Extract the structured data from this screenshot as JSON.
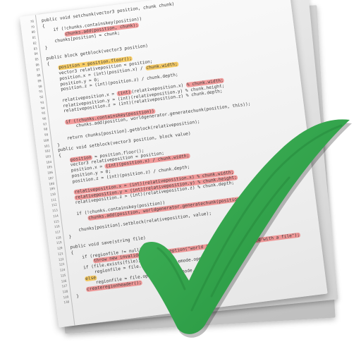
{
  "code_lines": [
    {
      "num": "78",
      "segments": [
        {
          "text": "public void setchunk(vector3 position, chunk chunk)"
        }
      ]
    },
    {
      "num": "79",
      "segments": [
        {
          "text": "{"
        }
      ]
    },
    {
      "num": "80",
      "segments": [
        {
          "text": "    if (!chunks.containskey(position))"
        }
      ]
    },
    {
      "num": "81",
      "segments": [
        {
          "text": "        "
        },
        {
          "text": "chunks.add(position, chunk);",
          "hl": "red"
        }
      ]
    },
    {
      "num": "82",
      "segments": [
        {
          "text": "    chunks[position] = chunk;"
        }
      ]
    },
    {
      "num": "83",
      "segments": [
        {
          "text": "}"
        }
      ]
    },
    {
      "num": "84",
      "segments": [
        {
          "text": ""
        }
      ]
    },
    {
      "num": "85",
      "segments": [
        {
          "text": "public block getblock(vector3 position)"
        }
      ]
    },
    {
      "num": "86",
      "segments": [
        {
          "text": "{"
        }
      ]
    },
    {
      "num": "87",
      "segments": [
        {
          "text": "    "
        },
        {
          "text": "position = position.floor();",
          "hl": "orange"
        }
      ]
    },
    {
      "num": "88",
      "segments": [
        {
          "text": "    vector3 relativeposition = position;"
        }
      ]
    },
    {
      "num": "89",
      "segments": [
        {
          "text": "    position.x = (int)(position.x) / "
        },
        {
          "text": "chunk.width;",
          "hl": "orange"
        }
      ]
    },
    {
      "num": "90",
      "segments": [
        {
          "text": "    position.y = 0;"
        }
      ]
    },
    {
      "num": "91",
      "segments": [
        {
          "text": "    position.z = (int)(position.z) / chunk.depth;"
        }
      ]
    },
    {
      "num": "92",
      "segments": [
        {
          "text": ""
        }
      ]
    },
    {
      "num": "93",
      "segments": [
        {
          "text": "    relativeposition.x = "
        },
        {
          "text": "(int)",
          "hl": "red"
        },
        {
          "text": "(relativeposition.x) "
        },
        {
          "text": "% chunk.width;",
          "hl": "red"
        }
      ]
    },
    {
      "num": "94",
      "segments": [
        {
          "text": "    relativeposition.y = (int)(relativeposition.y) % chunk.height;"
        }
      ]
    },
    {
      "num": "95",
      "segments": [
        {
          "text": "    relativeposition.z = (int)(relativeposition.z) % chunk.depth;"
        }
      ]
    },
    {
      "num": "96",
      "segments": [
        {
          "text": ""
        }
      ]
    },
    {
      "num": "97",
      "segments": [
        {
          "text": "    "
        },
        {
          "text": "if (!chunks.containskey(position))",
          "hl": "red"
        }
      ]
    },
    {
      "num": "98",
      "segments": [
        {
          "text": "        chunks.add(position, worldgenerator.generatechunk(position, this));"
        }
      ]
    },
    {
      "num": "99",
      "segments": [
        {
          "text": ""
        }
      ]
    },
    {
      "num": "100",
      "segments": [
        {
          "text": "    return chunks[position].getblock(relativeposition);"
        }
      ]
    },
    {
      "num": "101",
      "segments": [
        {
          "text": "}"
        }
      ]
    },
    {
      "num": "102",
      "segments": [
        {
          "text": "public void setblock(vector3 position, block value)"
        }
      ]
    },
    {
      "num": "103",
      "segments": [
        {
          "text": "{"
        }
      ]
    },
    {
      "num": "104",
      "segments": [
        {
          "text": "    "
        },
        {
          "text": "position",
          "hl": "red"
        },
        {
          "text": " = position.floor();"
        }
      ]
    },
    {
      "num": "105",
      "segments": [
        {
          "text": "    vector3 relativeposition = position;"
        }
      ]
    },
    {
      "num": "106",
      "segments": [
        {
          "text": "    position.x = "
        },
        {
          "text": "(int)(position.x) / chunk.width;",
          "hl": "red"
        }
      ]
    },
    {
      "num": "107",
      "segments": [
        {
          "text": "    position.y = 0;"
        }
      ]
    },
    {
      "num": "108",
      "segments": [
        {
          "text": "    position.z = (int)(position.z) / chunk.depth;"
        }
      ]
    },
    {
      "num": "109",
      "segments": [
        {
          "text": ""
        }
      ]
    },
    {
      "num": "110",
      "segments": [
        {
          "text": "    "
        },
        {
          "text": "relativeposition.x = (int)(relativeposition.x) % chunk.width;",
          "hl": "red"
        }
      ]
    },
    {
      "num": "111",
      "segments": [
        {
          "text": "    "
        },
        {
          "text": "relativeposition.y = (int)(relativeposition.y) % chunk.height;",
          "hl": "red"
        }
      ]
    },
    {
      "num": "112",
      "segments": [
        {
          "text": "    relativeposition.z = (int)(relativeposition.z) % chunk.depth;"
        }
      ]
    },
    {
      "num": "113",
      "segments": [
        {
          "text": ""
        }
      ]
    },
    {
      "num": "114",
      "segments": [
        {
          "text": "    if (!chunks.containskey(position))"
        }
      ]
    },
    {
      "num": "115",
      "segments": [
        {
          "text": "        "
        },
        {
          "text": "chunks.add(position, worldgenerator.generatechunk(position, this));",
          "hl": "red"
        }
      ]
    },
    {
      "num": "116",
      "segments": [
        {
          "text": ""
        }
      ]
    },
    {
      "num": "117",
      "segments": [
        {
          "text": "    chunks[position].setblock(relativeposition, value);"
        }
      ]
    },
    {
      "num": "118",
      "segments": [
        {
          "text": "}"
        }
      ]
    },
    {
      "num": "119",
      "segments": [
        {
          "text": ""
        }
      ]
    },
    {
      "num": "120",
      "segments": [
        {
          "text": "public void save(string file)"
        }
      ]
    },
    {
      "num": "121",
      "segments": [
        {
          "text": "{"
        }
      ]
    },
    {
      "num": "122",
      "segments": [
        {
          "text": "    if (regionfile != null)"
        }
      ]
    },
    {
      "num": "123",
      "segments": [
        {
          "text": "        "
        },
        {
          "text": "throw new invalidoperationexception(\"world is already associated with a file\");",
          "hl": "red"
        }
      ]
    },
    {
      "num": "124",
      "segments": [
        {
          "text": "    if (file.exists(file))"
        }
      ]
    },
    {
      "num": "125",
      "segments": [
        {
          "text": "        regionfile = file.open(file, filemode.openorcreate);"
        }
      ]
    },
    {
      "num": "126",
      "segments": [
        {
          "text": "    "
        },
        {
          "text": "else",
          "hl": "orange"
        }
      ]
    },
    {
      "num": "127",
      "segments": [
        {
          "text": "        regionfile = file.open(file, filemode.openorcreate);"
        }
      ]
    },
    {
      "num": "128",
      "segments": [
        {
          "text": "    "
        },
        {
          "text": "createregionheader();",
          "hl": "red"
        }
      ]
    },
    {
      "num": "129",
      "segments": [
        {
          "text": "}"
        }
      ]
    },
    {
      "num": "130",
      "segments": [
        {
          "text": ""
        }
      ]
    }
  ],
  "icons": {
    "checkmark": "checkmark-icon"
  },
  "colors": {
    "check_green": "#34a853",
    "check_dark": "#1f7a33",
    "highlight_red": "#f06464",
    "highlight_orange": "#f8ba28",
    "paper": "#f6f6f6",
    "code_text": "#3e3e3e"
  }
}
